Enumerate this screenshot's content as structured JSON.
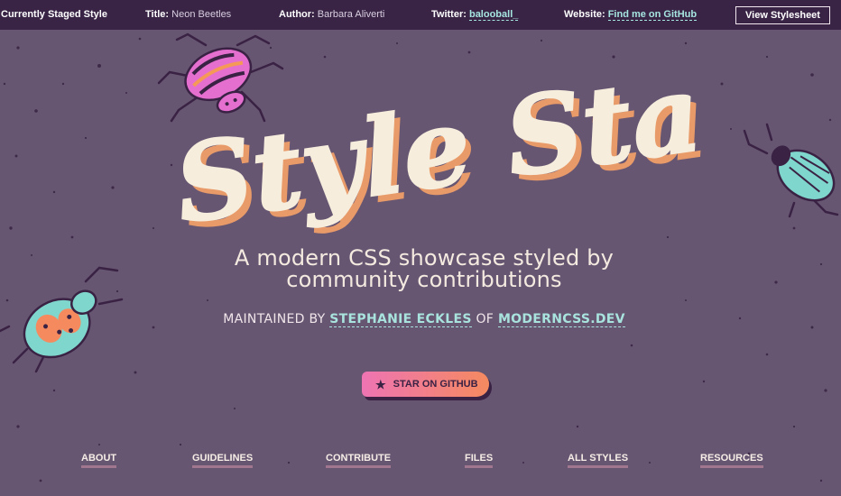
{
  "topbar": {
    "heading": "Currently Staged Style",
    "title_label": "Title:",
    "title_value": "Neon Beetles",
    "author_label": "Author:",
    "author_value": "Barbara Aliverti",
    "twitter_label": "Twitter:",
    "twitter_value": "balooball_",
    "website_label": "Website:",
    "website_value": "Find me on GitHub",
    "view_button": "View Stylesheet"
  },
  "hero": {
    "title": "Style Stage",
    "subtitle": "A modern CSS showcase styled by community contributions",
    "maintained_prefix": "MAINTAINED BY",
    "maintainer": "STEPHANIE ECKLES",
    "of": "OF",
    "site": "MODERNCSS.DEV"
  },
  "star_button": {
    "icon": "star-icon",
    "label": "STAR ON GITHUB"
  },
  "nav": {
    "items": [
      "ABOUT",
      "GUIDELINES",
      "CONTRIBUTE",
      "FILES",
      "ALL STYLES",
      "RESOURCES"
    ]
  },
  "colors": {
    "background": "#675672",
    "topbar": "#392446",
    "title_fill": "#f6eddc",
    "title_shadow": "#e89a68",
    "link": "#a8e3dd",
    "button_gradient_start": "#ee74b3",
    "button_gradient_end": "#f58a5f"
  }
}
